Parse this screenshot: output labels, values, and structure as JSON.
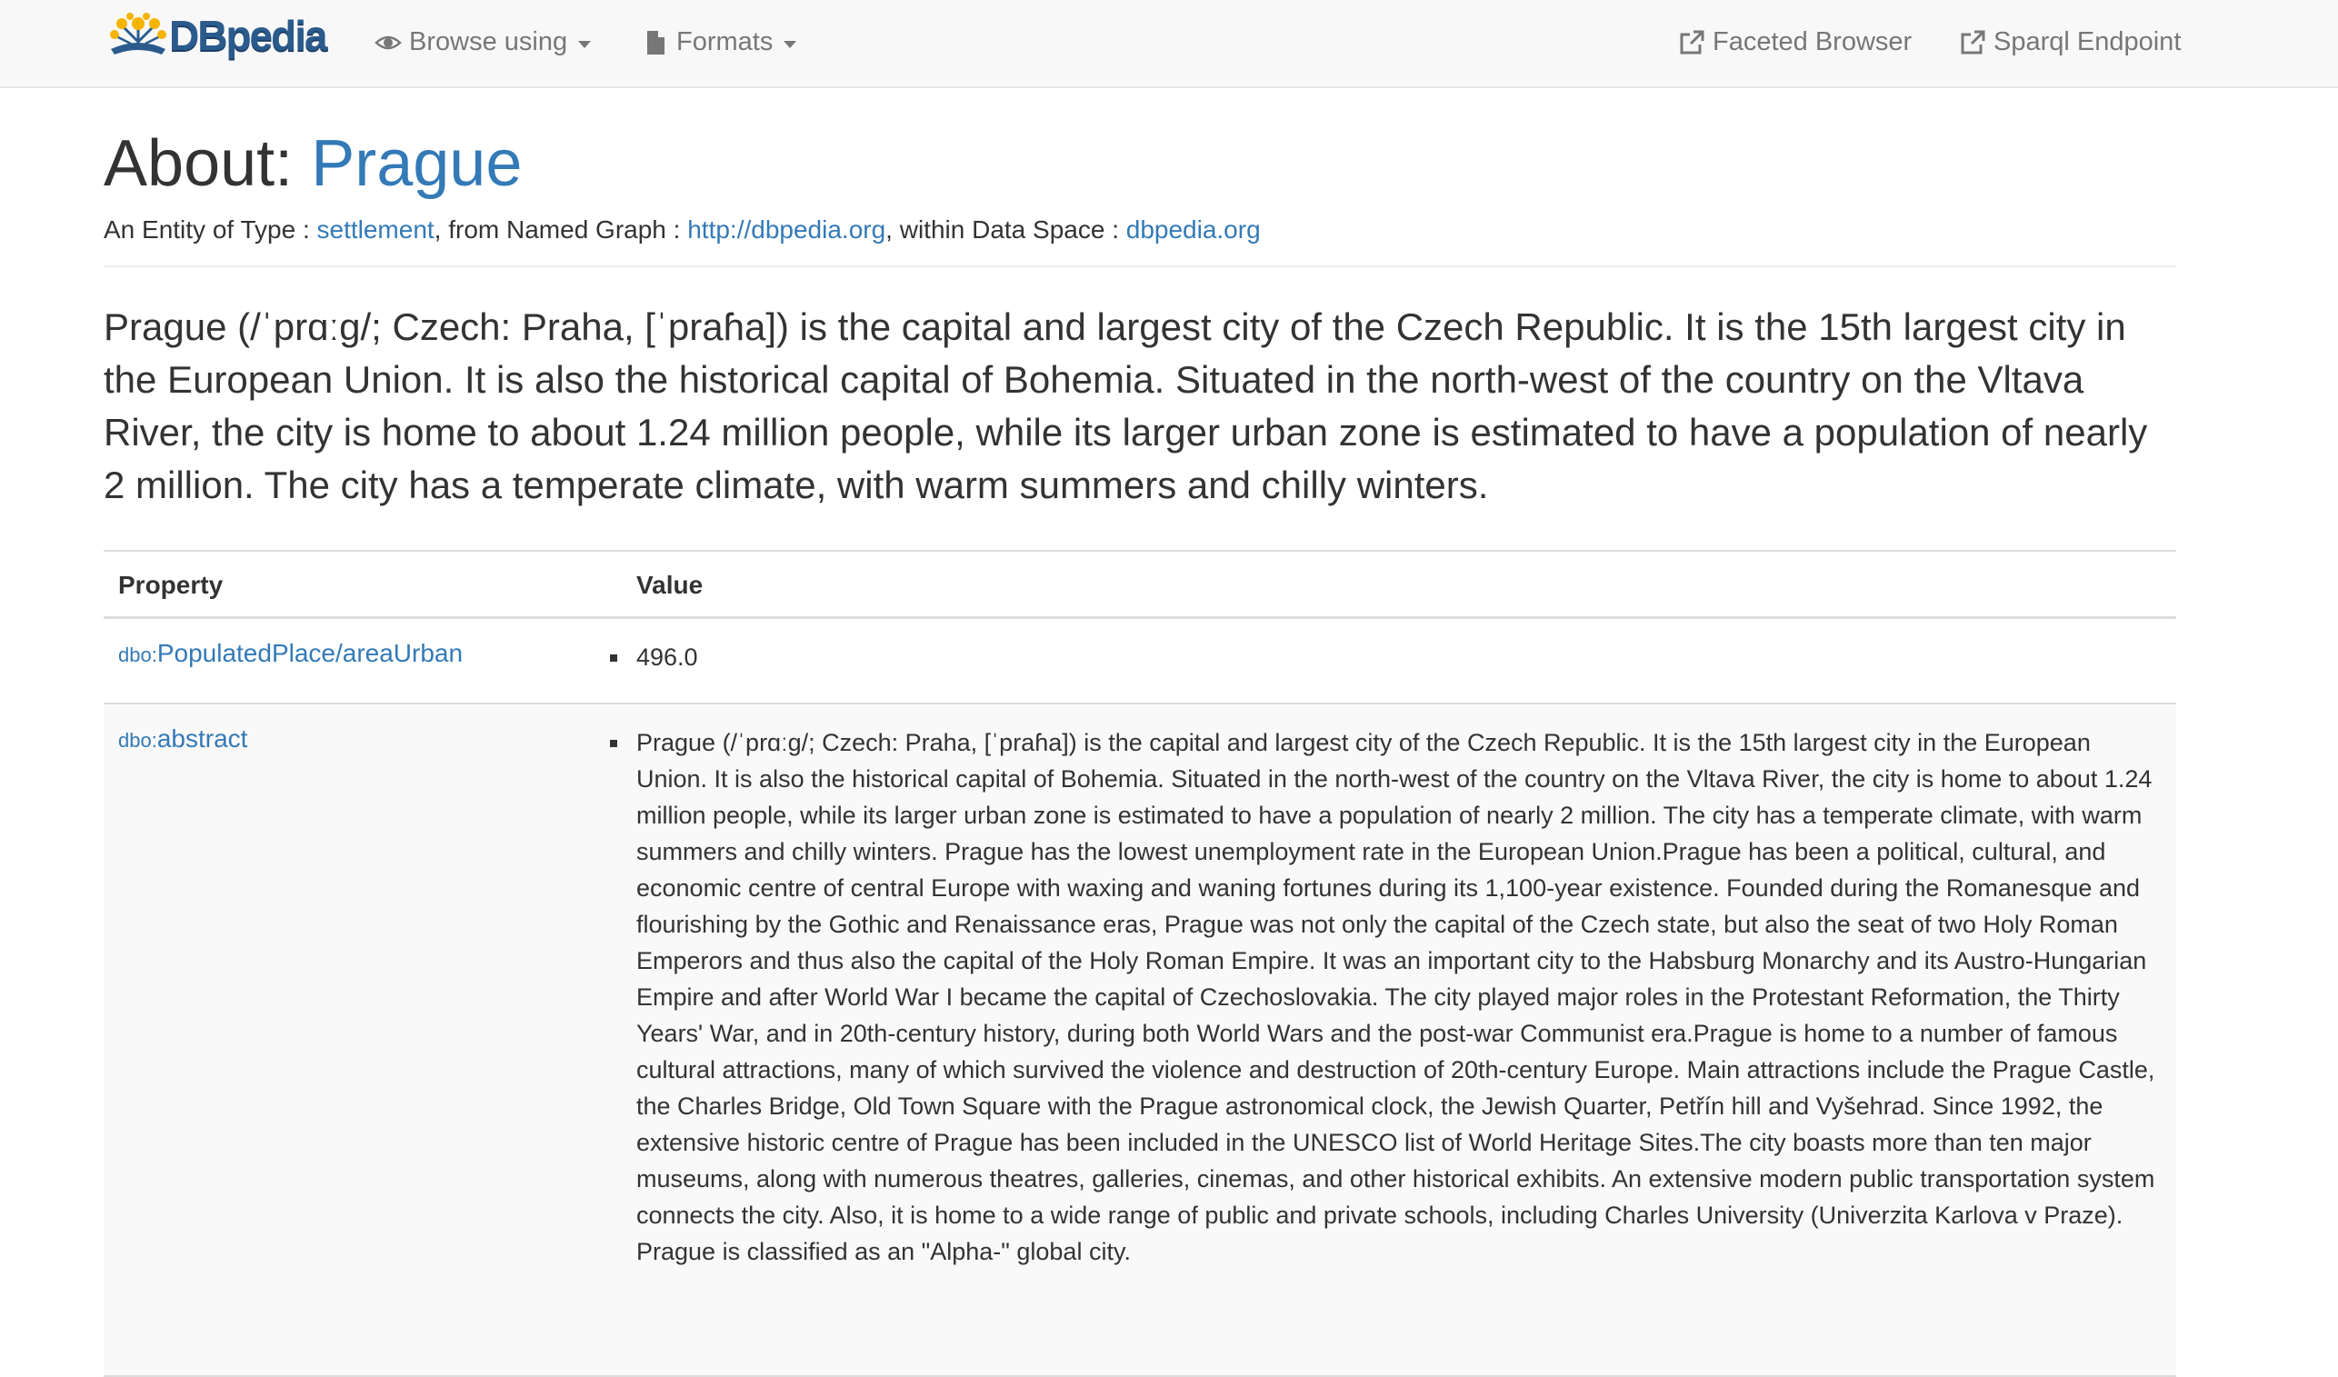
{
  "navbar": {
    "brand": "DBpedia",
    "browse_label": "Browse using",
    "formats_label": "Formats",
    "faceted_label": "Faceted Browser",
    "sparql_label": "Sparql Endpoint",
    "icons": {
      "browse": "eye-icon",
      "formats": "file-icon",
      "faceted": "external-link-icon",
      "sparql": "external-link-icon"
    }
  },
  "header": {
    "about_prefix": "About:",
    "entity": "Prague",
    "meta": {
      "type_prefix": "An Entity of Type : ",
      "type_link": "settlement",
      "graph_prefix": ", from Named Graph : ",
      "graph_link": "http://dbpedia.org",
      "space_prefix": ", within Data Space : ",
      "space_link": "dbpedia.org"
    }
  },
  "lead": "Prague (/ˈprɑːɡ/; Czech: Praha, [ˈpraɦa]) is the capital and largest city of the Czech Republic. It is the 15th largest city in the European Union. It is also the historical capital of Bohemia. Situated in the north-west of the country on the Vltava River, the city is home to about 1.24 million people, while its larger urban zone is estimated to have a population of nearly 2 million. The city has a temperate climate, with warm summers and chilly winters.",
  "table": {
    "headers": {
      "property": "Property",
      "value": "Value"
    },
    "rows": [
      {
        "prefix": "dbo:",
        "property": "PopulatedPlace/areaUrban",
        "value": "496.0"
      },
      {
        "prefix": "dbo:",
        "property": "abstract",
        "value": "Prague (/ˈprɑːɡ/; Czech: Praha, [ˈpraɦa]) is the capital and largest city of the Czech Republic. It is the 15th largest city in the European Union. It is also the historical capital of Bohemia. Situated in the north-west of the country on the Vltava River, the city is home to about 1.24 million people, while its larger urban zone is estimated to have a population of nearly 2 million. The city has a temperate climate, with warm summers and chilly winters. Prague has the lowest unemployment rate in the European Union.Prague has been a political, cultural, and economic centre of central Europe with waxing and waning fortunes during its 1,100-year existence. Founded during the Romanesque and flourishing by the Gothic and Renaissance eras, Prague was not only the capital of the Czech state, but also the seat of two Holy Roman Emperors and thus also the capital of the Holy Roman Empire. It was an important city to the Habsburg Monarchy and its Austro-Hungarian Empire and after World War I became the capital of Czechoslovakia. The city played major roles in the Protestant Reformation, the Thirty Years' War, and in 20th-century history, during both World Wars and the post-war Communist era.Prague is home to a number of famous cultural attractions, many of which survived the violence and destruction of 20th-century Europe. Main attractions include the Prague Castle, the Charles Bridge, Old Town Square with the Prague astronomical clock, the Jewish Quarter, Petřín hill and Vyšehrad. Since 1992, the extensive historic centre of Prague has been included in the UNESCO list of World Heritage Sites.The city boasts more than ten major museums, along with numerous theatres, galleries, cinemas, and other historical exhibits. An extensive modern public transportation system connects the city. Also, it is home to a wide range of public and private schools, including Charles University (Univerzita Karlova v Praze). Prague is classified as an \"Alpha-\" global city."
      }
    ]
  }
}
